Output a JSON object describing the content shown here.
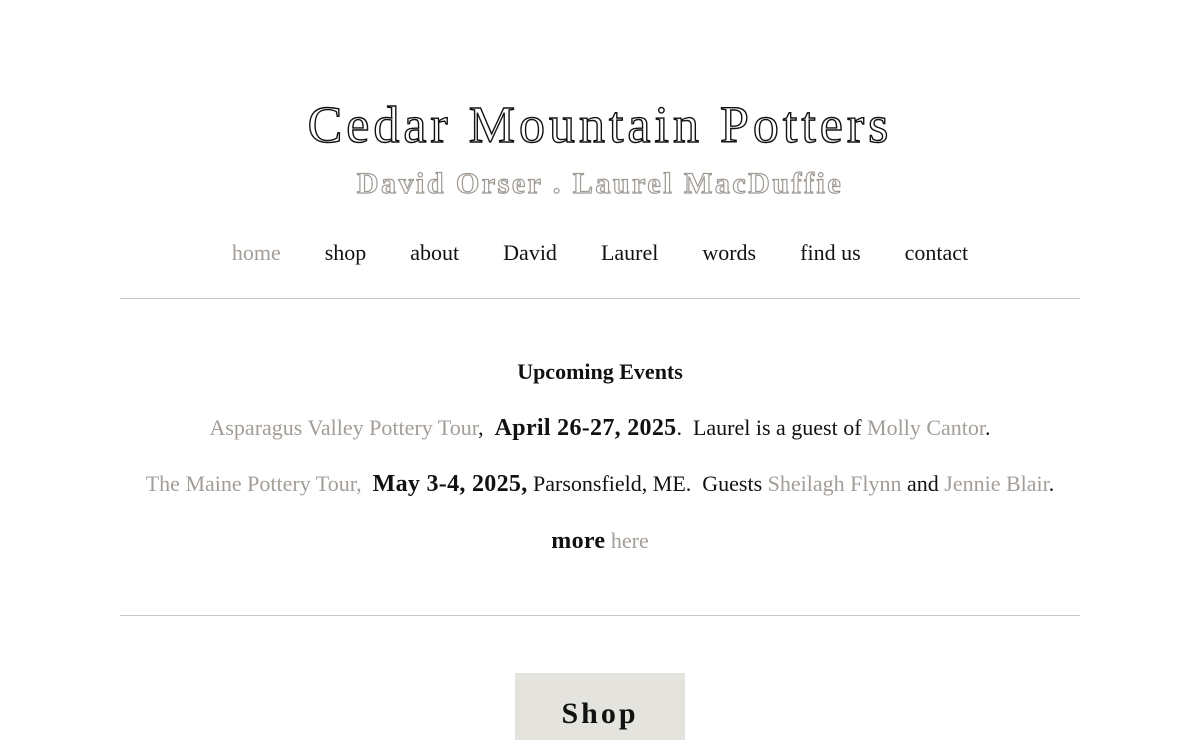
{
  "header": {
    "title": "Cedar Mountain Potters",
    "subtitle": "David Orser . Laurel MacDuffie"
  },
  "nav": {
    "items": [
      {
        "label": "home",
        "active": true
      },
      {
        "label": "shop"
      },
      {
        "label": "about"
      },
      {
        "label": "David"
      },
      {
        "label": "Laurel"
      },
      {
        "label": "words"
      },
      {
        "label": "find us"
      },
      {
        "label": "contact"
      }
    ]
  },
  "events": {
    "heading": "Upcoming Events",
    "event1": {
      "tour_link": "Asparagus Valley Pottery Tour",
      "sep": ",",
      "date": "April 26-27, 2025",
      "text": ".  Laurel is a guest of ",
      "guest_link": "Molly Cantor",
      "end": "."
    },
    "event2": {
      "tour_link": "The Maine Pottery Tour,",
      "date": "May 3-4, 2025,",
      "text": " Parsonsfield, ME.  Guests ",
      "guest1_link": "Sheilagh Flynn",
      "and": " and ",
      "guest2_link": "Jennie Blair",
      "end": "."
    },
    "more": {
      "label": "more",
      "link": "here"
    }
  },
  "shop_button": {
    "label": "Shop"
  },
  "colors": {
    "link": "#a39d97",
    "text": "#111111",
    "button_bg": "#e4e3de",
    "rule": "#c8c8c8"
  }
}
